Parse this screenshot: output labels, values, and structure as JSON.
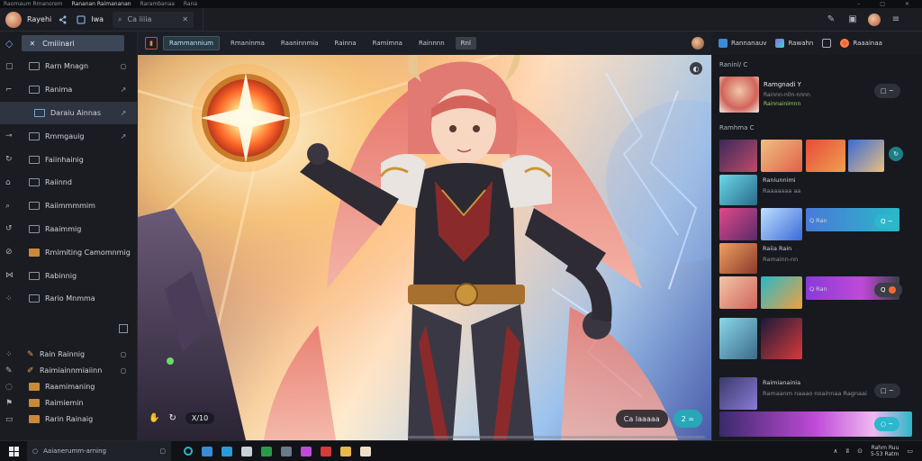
{
  "titlebar": {
    "tabs": [
      "Raomaum Rmanorem",
      "Rananan Raimananan",
      "Rarambanaa",
      "Rana"
    ],
    "controls": [
      "–",
      "□",
      "✕"
    ]
  },
  "topbar": {
    "user_label": "Rayehi",
    "app_label": "Iwa",
    "search_text": "Ca iiiia",
    "search_close": "✕"
  },
  "sidebar": {
    "head_label": "Cmiiinari",
    "items": [
      {
        "label": "Rarn Mnagn",
        "end": "○"
      },
      {
        "label": "Ranima",
        "end": "↗"
      },
      {
        "label": "Daraiu Ainnas",
        "end": "↗",
        "active": true
      },
      {
        "label": "Rmmgauig",
        "end": "↗"
      },
      {
        "label": "Faiinhainig",
        "end": ""
      },
      {
        "label": "Raiinnd",
        "end": ""
      },
      {
        "label": "Raiimmmmim",
        "end": ""
      },
      {
        "label": "Raaimmig",
        "end": ""
      },
      {
        "label": "Rmimiting Camomnmig",
        "end": ""
      },
      {
        "label": "Rabinnig",
        "end": ""
      },
      {
        "label": "Rario Mnmma",
        "end": ""
      }
    ],
    "bottom_items": [
      {
        "label": "Rain Rainnig",
        "end": "○"
      },
      {
        "label": "Raimiainnmiaiinn",
        "end": "○"
      },
      {
        "label": "Raamimaning",
        "end": ""
      },
      {
        "label": "Raimiemin",
        "end": ""
      },
      {
        "label": "Rarin Rainaig",
        "end": ""
      }
    ]
  },
  "toolbar": {
    "tabs": [
      "Rammannium",
      "Rmaninma",
      "Raaninnmia",
      "Rainna",
      "Ramimna",
      "Rainnnn",
      "Rnl"
    ],
    "active_index": 0
  },
  "image": {
    "ctrl_time": "X/10",
    "action_dark": "Ca Iaaaaa",
    "action_teal": "2 =",
    "corner": "◐"
  },
  "rpanel": {
    "head": [
      "Rannanauv",
      "Rawahn",
      "Raaainaa"
    ],
    "section1": "Raninl/ C",
    "feature_title": "Ramgnadi Y",
    "feature_sub": "Rainnn-n0n-nnnn",
    "feature_sub2": "Rainnainimnn",
    "feature_btn": "□ ~",
    "section2": "Ramhma C",
    "rows": [
      {
        "title": "Raniunnimi",
        "sub": "Raaaaaaa aa"
      },
      {
        "title": "Q Ran",
        "btn": "Q ~"
      },
      {
        "title": "Raiia Rain",
        "sub": "Ramainn-nn"
      },
      {
        "title": "Q Ran",
        "btn": "Q"
      },
      {
        "title": "Raimianainia",
        "sub": "Ramaanm naaao noainnaa Ragnaainaaaa"
      }
    ],
    "row_btn": "□ ~",
    "last_btn": "○ ~"
  },
  "taskbar": {
    "search_text": "Aaianerumm-arning",
    "clock_time": "Rahm Ruu",
    "clock_date": "5-53 Ratm",
    "tray": [
      "∧",
      "ʬ",
      "⊙"
    ]
  },
  "colors": {
    "accent": "#2cb8cc",
    "active_sidebar": "#2e3440",
    "pill": "#3c4656"
  }
}
